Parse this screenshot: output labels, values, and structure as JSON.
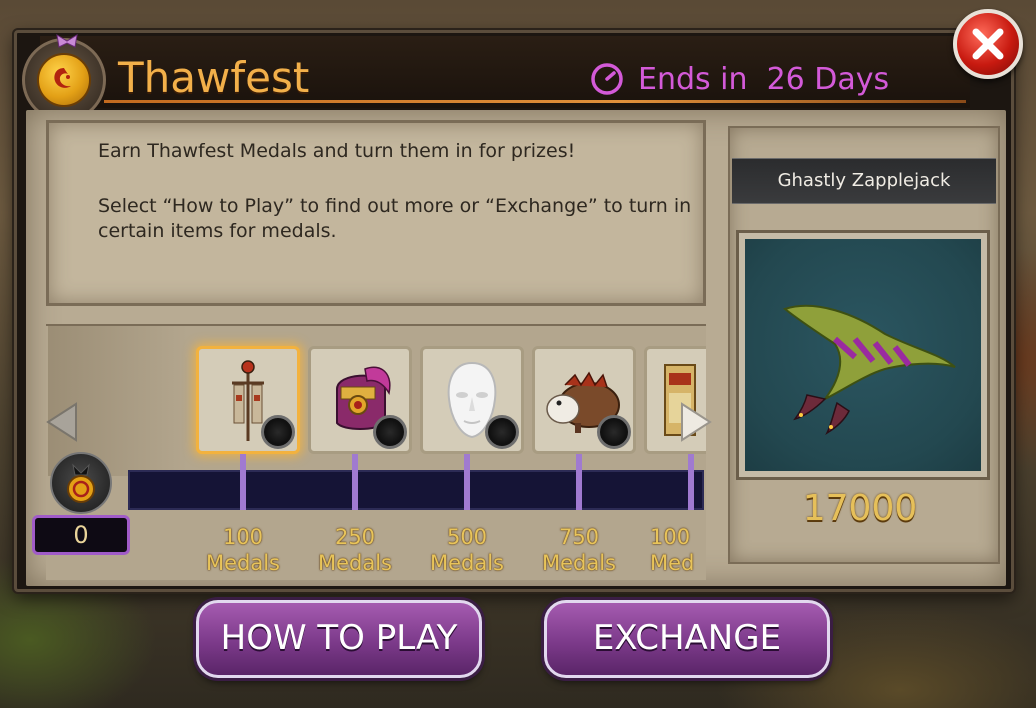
{
  "header": {
    "title": "Thawfest",
    "ends_label": "Ends in  26 Days"
  },
  "info": {
    "line1": "Earn Thawfest Medals and turn them in for prizes!",
    "line2": "Select “How to Play” to find out more or “Exchange” to turn in certain items for medals."
  },
  "prizes": [
    {
      "name": "banner-prize",
      "medals": "100",
      "unit": "Medals",
      "selected": true
    },
    {
      "name": "helmet-prize",
      "medals": "250",
      "unit": "Medals",
      "selected": false
    },
    {
      "name": "mask-prize",
      "medals": "500",
      "unit": "Medals",
      "selected": false
    },
    {
      "name": "boar-prize",
      "medals": "750",
      "unit": "Medals",
      "selected": false
    },
    {
      "name": "scroll-prize",
      "medals": "100",
      "unit": "Med",
      "selected": false
    }
  ],
  "medal_count": "0",
  "preview": {
    "name": "Ghastly Zapplejack",
    "price": "17000"
  },
  "buttons": {
    "how_to_play": "HOW TO PLAY",
    "exchange": "EXCHANGE"
  },
  "colors": {
    "title": "#f2b04a",
    "ends": "#d35ad8",
    "button": "#7c3a8a",
    "progress_track": "#151436",
    "tick": "#a07ad0"
  }
}
